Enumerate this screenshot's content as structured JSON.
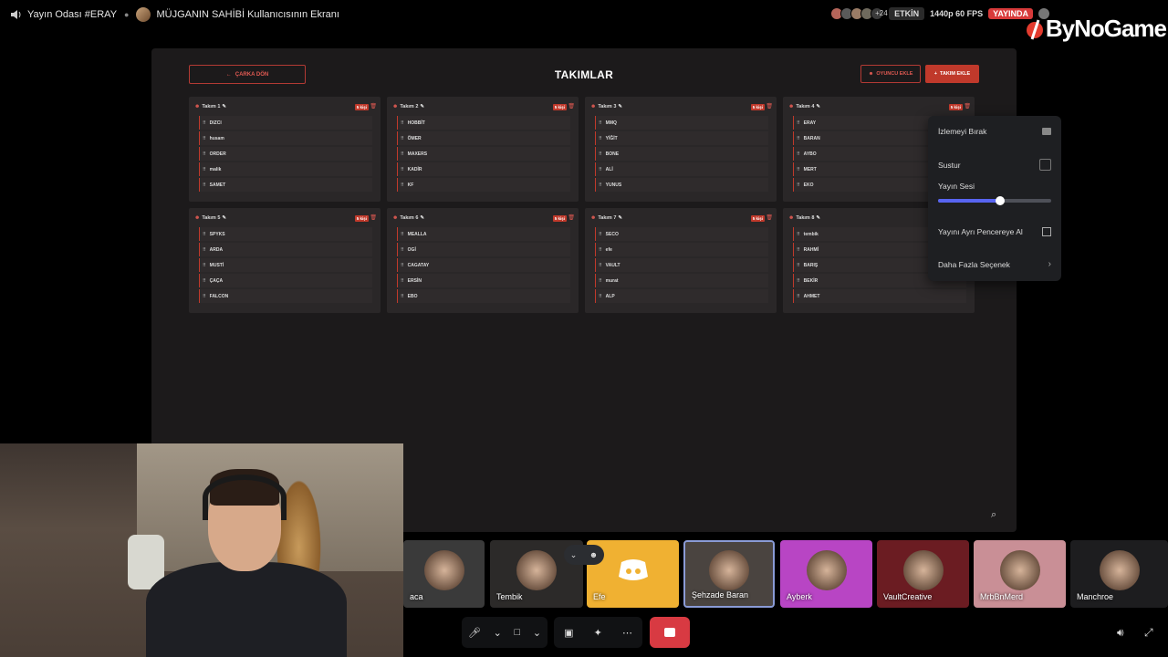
{
  "topbar": {
    "room": "Yayın Odası #ERAY",
    "screen_title": "MÜJGANIN SAHİBİ Kullanıcısının Ekranı",
    "viewer_extra": "+24",
    "activity": "ETKİN",
    "quality": "1440p 60 FPS",
    "live": "YAYINDA",
    "brand": "ByNoGame"
  },
  "stream": {
    "back_label": "ÇARKA DÖN",
    "title": "TAKIMLAR",
    "add_player_label": "OYUNCU EKLE",
    "add_team_label": "TAKIM EKLE",
    "teams": [
      {
        "name": "Takım 1",
        "badge": "5 kişi",
        "players": [
          "DIZCI",
          "husam",
          "ORDER",
          "malik",
          "SAMET"
        ]
      },
      {
        "name": "Takım 2",
        "badge": "5 kişi",
        "players": [
          "HOBBİT",
          "ÖMER",
          "MAXERS",
          "KADİR",
          "KF"
        ]
      },
      {
        "name": "Takım 3",
        "badge": "5 kişi",
        "players": [
          "MMQ",
          "YİĞİT",
          "BONE",
          "ALİ",
          "YUNUS"
        ]
      },
      {
        "name": "Takım 4",
        "badge": "5 kişi",
        "players": [
          "ERAY",
          "BARAN",
          "AYBO",
          "MERT",
          "EKO"
        ]
      },
      {
        "name": "Takım 5",
        "badge": "5 kişi",
        "players": [
          "SPYKS",
          "ARDA",
          "MUSTİ",
          "ÇAÇA",
          "FALCON"
        ]
      },
      {
        "name": "Takım 6",
        "badge": "5 kişi",
        "players": [
          "MEALLA",
          "OGİ",
          "CAGATAY",
          "ERSİN",
          "EBO"
        ]
      },
      {
        "name": "Takım 7",
        "badge": "5 kişi",
        "players": [
          "SECO",
          "efe",
          "VAULT",
          "murat",
          "ALP"
        ]
      },
      {
        "name": "Takım 8",
        "badge": "5 kişi",
        "players": [
          "tembik",
          "RAHMİ",
          "BARIŞ",
          "BEKİR",
          "AHMET"
        ]
      }
    ]
  },
  "menu": {
    "stop_watching": "İzlemeyi Bırak",
    "mute": "Sustur",
    "stream_volume": "Yayın Sesi",
    "volume_level": 0.55,
    "popout": "Yayını Ayrı Pencereye Al",
    "more_options": "Daha Fazla Seçenek"
  },
  "participants": [
    {
      "name": "aca",
      "bg": "#3a3a3a"
    },
    {
      "name": "Tembik",
      "bg": "#2c2a29"
    },
    {
      "name": "Efe",
      "bg": "#f0b132"
    },
    {
      "name": "Şehzade Baran",
      "bg": "#4a4440"
    },
    {
      "name": "Ayberk",
      "bg": "#b845c4"
    },
    {
      "name": "VaultCreative",
      "bg": "#6b1c22"
    },
    {
      "name": "MrbBnMerd",
      "bg": "#c98f96"
    },
    {
      "name": "Manchroe",
      "bg": "#1d1d1f"
    }
  ],
  "colors": {
    "accent_red": "#c0392b",
    "slider_blue": "#5865f2",
    "end_call": "#d83a42"
  }
}
